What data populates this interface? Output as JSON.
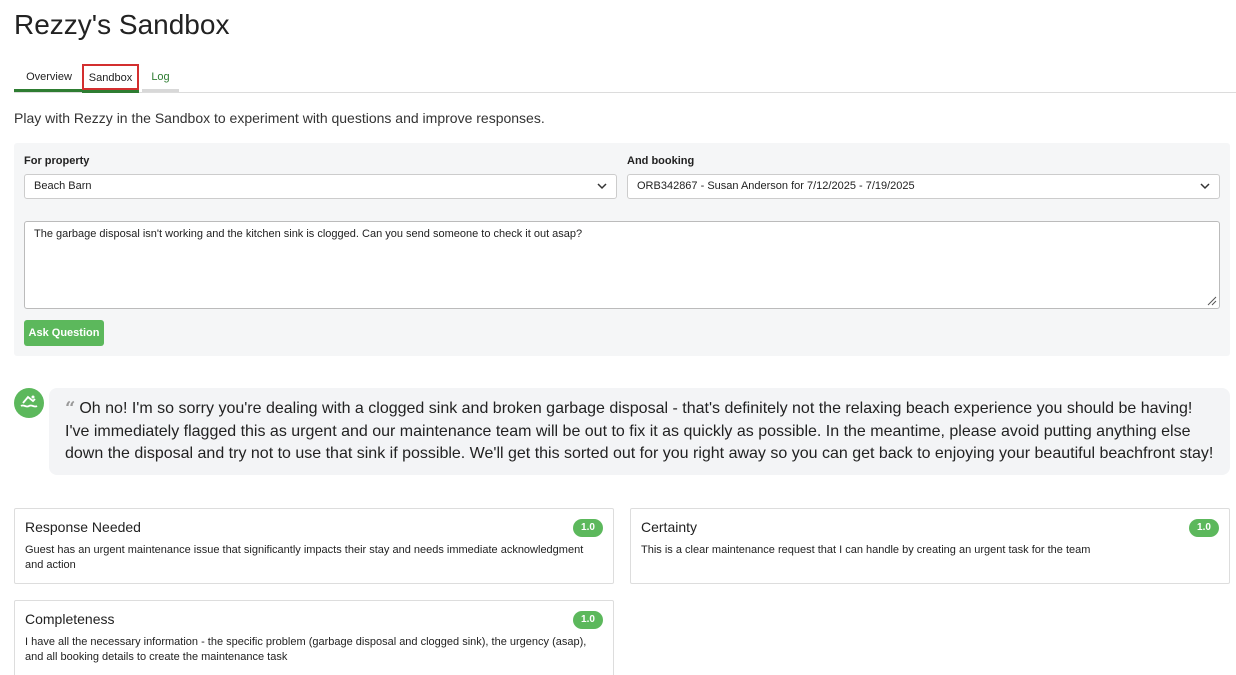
{
  "page": {
    "title": "Rezzy's Sandbox"
  },
  "tabs": [
    {
      "label": "Overview"
    },
    {
      "label": "Sandbox"
    },
    {
      "label": "Log"
    }
  ],
  "intro": "Play with Rezzy in the Sandbox to experiment with questions and improve responses.",
  "form": {
    "property_label": "For property",
    "property_value": "Beach Barn",
    "booking_label": "And booking",
    "booking_value": "ORB342867 - Susan Anderson for 7/12/2025 - 7/19/2025",
    "question_value": "The garbage disposal isn't working and the kitchen sink is clogged. Can you send someone to check it out asap?",
    "ask_label": "Ask Question"
  },
  "reply": {
    "text": "Oh no! I'm so sorry you're dealing with a clogged sink and broken garbage disposal - that's definitely not the relaxing beach experience you should be having! I've immediately flagged this as urgent and our maintenance team will be out to fix it as quickly as possible. In the meantime, please avoid putting anything else down the disposal and try not to use that sink if possible. We'll get this sorted out for you right away so you can get back to enjoying your beautiful beachfront stay!"
  },
  "cards": {
    "response_needed": {
      "title": "Response Needed",
      "score": "1.0",
      "text": "Guest has an urgent maintenance issue that significantly impacts their stay and needs immediate acknowledgment and action"
    },
    "certainty": {
      "title": "Certainty",
      "score": "1.0",
      "text": "This is a clear maintenance request that I can handle by creating an urgent task for the team"
    },
    "completeness": {
      "title": "Completeness",
      "score": "1.0",
      "text": "I have all the necessary information - the specific problem (garbage disposal and clogged sink), the urgency (asap), and all booking details to create the maintenance task"
    }
  },
  "colors": {
    "accent": "#5cb85c",
    "tab_active": "#2e7d32",
    "highlight": "#d32f2f"
  }
}
